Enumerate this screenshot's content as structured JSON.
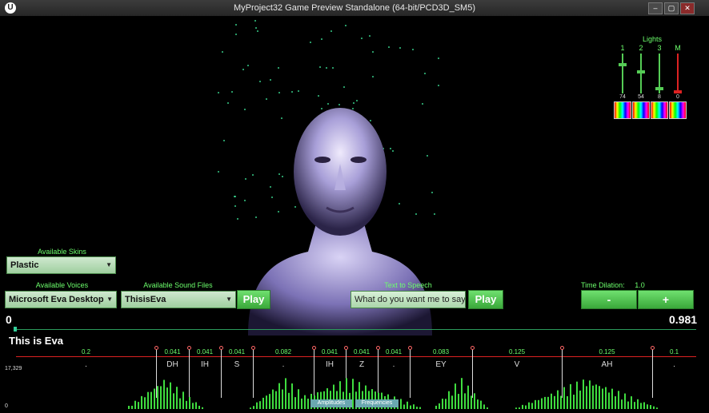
{
  "window": {
    "title": "MyProject32 Game Preview Standalone (64-bit/PCD3D_SM5)",
    "logo": "U"
  },
  "lights": {
    "title": "Lights",
    "channels": [
      {
        "label": "1",
        "value": "74",
        "level": 0.74,
        "color": "#5c5"
      },
      {
        "label": "2",
        "value": "54",
        "level": 0.54,
        "color": "#5c5"
      },
      {
        "label": "3",
        "value": "8",
        "level": 0.08,
        "color": "#5c5"
      },
      {
        "label": "M",
        "value": "0",
        "level": 0.0,
        "color": "#d22"
      }
    ]
  },
  "skins": {
    "label": "Available Skins",
    "selected": "Plastic"
  },
  "voices": {
    "label": "Available Voices",
    "selected": "Microsoft Eva Desktop"
  },
  "sound_files": {
    "label": "Available Sound Files",
    "selected": "ThisisEva",
    "play": "Play"
  },
  "tts": {
    "label": "Text to Speech",
    "value": "What do you want me to say",
    "play": "Play"
  },
  "time_dilation": {
    "label": "Time Dilation:",
    "value": "1.0",
    "minus": "-",
    "plus": "+"
  },
  "timeline": {
    "start": "0",
    "end": "0.981",
    "caption": "This is Eva"
  },
  "phonemes": {
    "durations": [
      "0.2",
      "0.041",
      "0.041",
      "0.041",
      "0.082",
      "0.041",
      "0.041",
      "0.041",
      "0.083",
      "0.125",
      "0.125",
      "0.1"
    ],
    "labels": [
      ".",
      "DH",
      "IH",
      "S",
      ".",
      "IH",
      "Z",
      ".",
      "EY",
      "V",
      "AH",
      "."
    ]
  },
  "graph": {
    "ymax": "17,329",
    "ymin": "0",
    "tab1": "Amplitudes",
    "tab2": "Frequencies"
  }
}
